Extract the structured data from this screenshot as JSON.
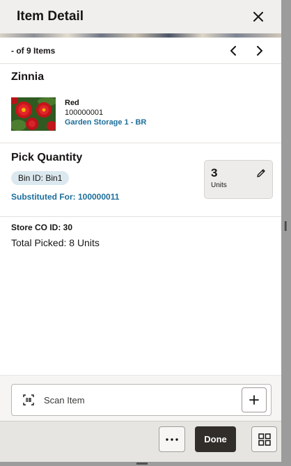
{
  "header": {
    "title": "Item Detail",
    "close_icon": "close-icon"
  },
  "pager": {
    "text": "- of 9 Items",
    "prev_icon": "chevron-left-icon",
    "next_icon": "chevron-right-icon"
  },
  "product": {
    "name": "Zinnia",
    "color": "Red",
    "sku": "100000001",
    "location": "Garden Storage 1 - BR",
    "image": "red-zinnia-flowers-photo"
  },
  "pick": {
    "title": "Pick Quantity",
    "bin_chip": "Bin ID: Bin1",
    "substituted": "Substituted For: 100000011",
    "quantity": "3",
    "unit": "Units",
    "edit_icon": "pencil-icon"
  },
  "store": {
    "co_id": "Store CO ID: 30",
    "total_picked": "Total Picked: 8 Units"
  },
  "scan": {
    "label": "Scan Item",
    "scan_icon": "barcode-scan-icon",
    "add_icon": "plus-icon"
  },
  "footer": {
    "more_icon": "more-icon",
    "done_label": "Done",
    "grid_icon": "grid-icon"
  },
  "colors": {
    "link": "#1d6e9a",
    "chip": "#dbe8ef",
    "primary_button": "#312d2a",
    "header_bg": "#f1efed"
  }
}
